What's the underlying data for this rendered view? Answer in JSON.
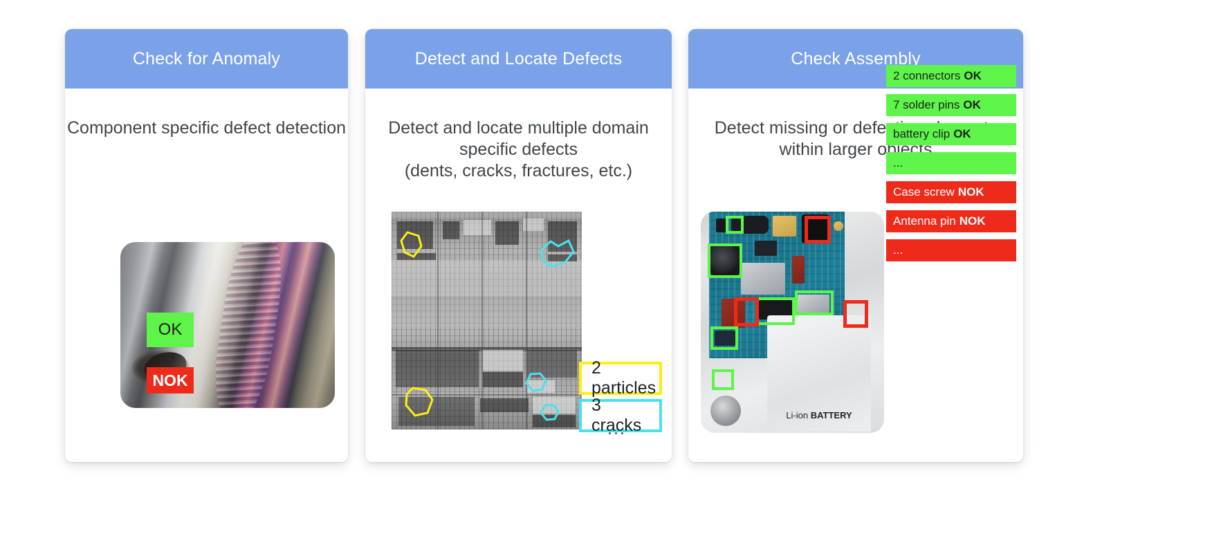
{
  "page": {
    "background": "#ffffff",
    "header_color": "#7ba1e8",
    "ok_color": "#5ef449",
    "nok_color": "#ee2b1b",
    "yellow": "#ffee12",
    "cyan": "#4ae1ef"
  },
  "cards": [
    {
      "id": "check-for-anomaly",
      "title": "Check for Anomaly",
      "description": "Component specific defect detection",
      "image_alt": "welded-flange-photo",
      "badges": [
        {
          "label": "OK",
          "state": "ok"
        },
        {
          "label": "NOK",
          "state": "nok"
        }
      ]
    },
    {
      "id": "detect-and-locate-defects",
      "title": "Detect and Locate Defects",
      "description_line1": "Detect and locate multiple domain",
      "description_line2": "specific defects",
      "description_line3": "(dents, cracks, fractures, etc.)",
      "image_alt": "grayscale-wafer-inspection-image",
      "callouts": [
        {
          "label": "2 particles",
          "color": "#ffee12"
        },
        {
          "label": "3 cracks",
          "color": "#4ae1ef"
        }
      ],
      "more": "..."
    },
    {
      "id": "check-assembly",
      "title": "Check Assembly",
      "description_line1": "Detect missing or defective elements",
      "description_line2": "within larger objects",
      "image_alt": "smartphone-teardown-pcb-photo",
      "battery_label_prefix": "Li-ion ",
      "battery_label_bold": "BATTERY",
      "status_items": [
        {
          "text": "2 connectors",
          "verdict": "OK",
          "state": "ok"
        },
        {
          "text": "7 solder pins",
          "verdict": "OK",
          "state": "ok"
        },
        {
          "text": "battery clip",
          "verdict": "OK",
          "state": "ok"
        },
        {
          "text": "...",
          "verdict": "",
          "state": "ok"
        },
        {
          "text": "Case screw",
          "verdict": "NOK",
          "state": "nok"
        },
        {
          "text": "Antenna pin",
          "verdict": "NOK",
          "state": "nok"
        },
        {
          "text": "...",
          "verdict": "",
          "state": "nok"
        }
      ]
    }
  ]
}
